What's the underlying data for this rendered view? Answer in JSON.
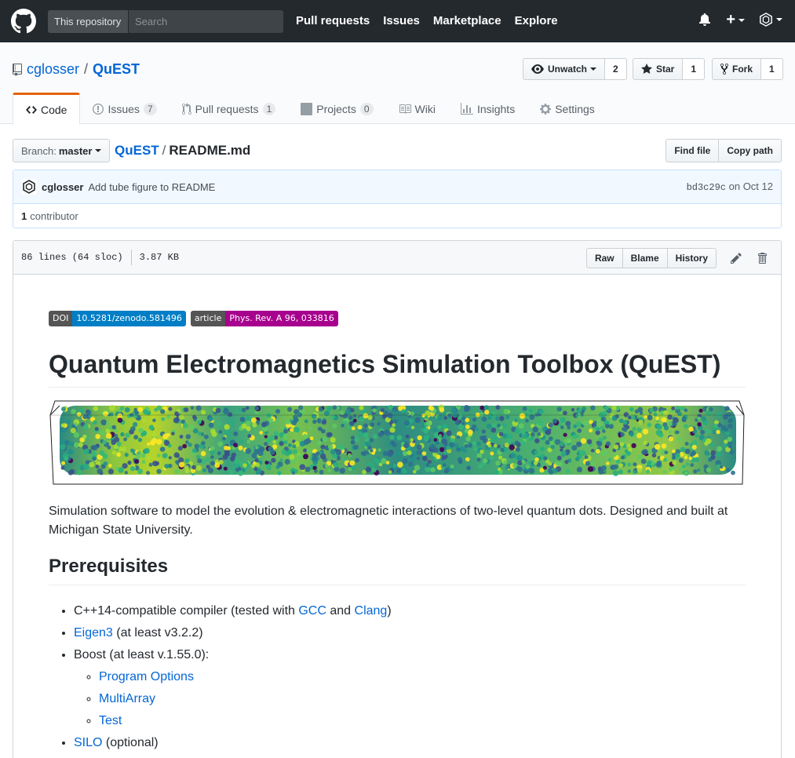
{
  "header": {
    "scope_label": "This repository",
    "search_placeholder": "Search",
    "nav": [
      "Pull requests",
      "Issues",
      "Marketplace",
      "Explore"
    ]
  },
  "repo": {
    "owner": "cglosser",
    "name": "QuEST",
    "unwatch_label": "Unwatch",
    "watch_count": "2",
    "star_label": "Star",
    "star_count": "1",
    "fork_label": "Fork",
    "fork_count": "1"
  },
  "tabs": [
    {
      "label": "Code"
    },
    {
      "label": "Issues",
      "count": "7"
    },
    {
      "label": "Pull requests",
      "count": "1"
    },
    {
      "label": "Projects",
      "count": "0"
    },
    {
      "label": "Wiki"
    },
    {
      "label": "Insights"
    },
    {
      "label": "Settings"
    }
  ],
  "file_nav": {
    "branch_label": "Branch:",
    "branch": "master",
    "crumb_root": "QuEST",
    "crumb_sep": "/",
    "file": "README.md",
    "find_file": "Find file",
    "copy_path": "Copy path"
  },
  "commit": {
    "author": "cglosser",
    "message": "Add tube figure to README",
    "sha": "bd3c29c",
    "date": "on Oct 12",
    "contributors_count": "1",
    "contributors_label": "contributor"
  },
  "file_info": {
    "lines": "86 lines (64 sloc)",
    "size": "3.87 KB",
    "raw": "Raw",
    "blame": "Blame",
    "history": "History"
  },
  "readme": {
    "badge_doi_label": "DOI",
    "badge_doi_value": "10.5281/zenodo.581496",
    "badge_article_label": "article",
    "badge_article_value": "Phys. Rev. A 96, 033816",
    "title": "Quantum Electromagnetics Simulation Toolbox (QuEST)",
    "intro": "Simulation software to model the evolution & electromagnetic interactions of two-level quantum dots. Designed and built at Michigan State University.",
    "prereq_heading": "Prerequisites",
    "req1_text": "C++14-compatible compiler (tested with ",
    "req1_link1": "GCC",
    "req1_and": " and ",
    "req1_link2": "Clang",
    "req1_end": ")",
    "req2_link": "Eigen3",
    "req2_text": " (at least v3.2.2)",
    "req3_text": "Boost (at least v.1.55.0):",
    "boost_libs": [
      "Program Options",
      "MultiArray",
      "Test"
    ],
    "req4_link": "SILO",
    "req4_text": " (optional)"
  },
  "colors": {
    "header_bg": "#24292e",
    "link": "#0366d6",
    "tab_accent": "#e36209",
    "doi_badge": "#007ec6",
    "article_badge": "#a8008e"
  }
}
